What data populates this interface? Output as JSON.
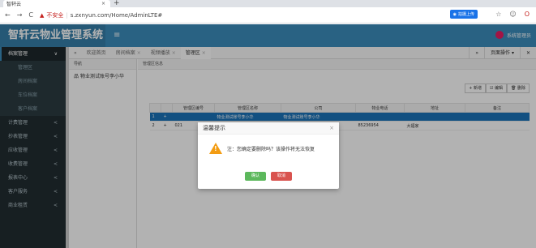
{
  "browser": {
    "tab_title": "智轩云",
    "tab_close": "×",
    "new_tab": "+",
    "nav_back": "←",
    "nav_forward": "→",
    "nav_reload": "C",
    "insecure_label": "不安全",
    "url": "s.zxnyun.com/Home/AdminLTE#",
    "extension_label": "拍摄上传",
    "star": "☆",
    "account": "☺",
    "menu": "O"
  },
  "header": {
    "logo": "智轩云物业管理系统",
    "menu_toggle": "≡",
    "user_name": "系统管理员"
  },
  "sidebar": {
    "items": [
      {
        "label": "档案管理",
        "chev": "∨",
        "active": true
      },
      {
        "label": "管理区"
      },
      {
        "label": "房间档案"
      },
      {
        "label": "车位档案"
      },
      {
        "label": "客户档案"
      },
      {
        "label": "计费管理",
        "chev": "<"
      },
      {
        "label": "抄表管理",
        "chev": "<"
      },
      {
        "label": "应收管理",
        "chev": "<"
      },
      {
        "label": "收费管理",
        "chev": "<"
      },
      {
        "label": "报表中心",
        "chev": "<"
      },
      {
        "label": "客户服务",
        "chev": "<"
      },
      {
        "label": "商业租赁",
        "chev": "<"
      }
    ]
  },
  "content_tabs": {
    "prev": "«",
    "tabs": [
      {
        "label": "欢迎首页",
        "close": ""
      },
      {
        "label": "房间档案",
        "close": "×"
      },
      {
        "label": "视频播放",
        "close": "×"
      },
      {
        "label": "管理区",
        "close": "×"
      }
    ],
    "next": "»",
    "page_ops": "页面操作 ▾",
    "close_all": "✕"
  },
  "tree": {
    "header": "导航",
    "node": "物业测试账号李小华"
  },
  "main": {
    "panel_header": "管理区信息",
    "toolbar": {
      "add": "+ 新增",
      "edit": "☑ 编辑",
      "delete": "🗑 删除"
    },
    "columns": [
      "",
      "",
      "管理区编号",
      "管理区名称",
      "公司",
      "物业电话",
      "地址",
      "备注"
    ],
    "rows": [
      {
        "no": "1",
        "expand": "+",
        "code": "",
        "name": "物业测试账号李小华",
        "company": "物业测试账号李小华",
        "phone": "",
        "address": "",
        "remark": "",
        "selected": true
      },
      {
        "no": "2",
        "expand": "+",
        "code": "021",
        "name": "",
        "company": "",
        "phone": "85236954",
        "address": "大福家",
        "remark": "",
        "selected": false
      }
    ]
  },
  "modal": {
    "title": "温馨提示",
    "close": "×",
    "message": "注：您确定要删除吗？该操作将无法恢复",
    "ok": "确认",
    "cancel": "取消"
  }
}
